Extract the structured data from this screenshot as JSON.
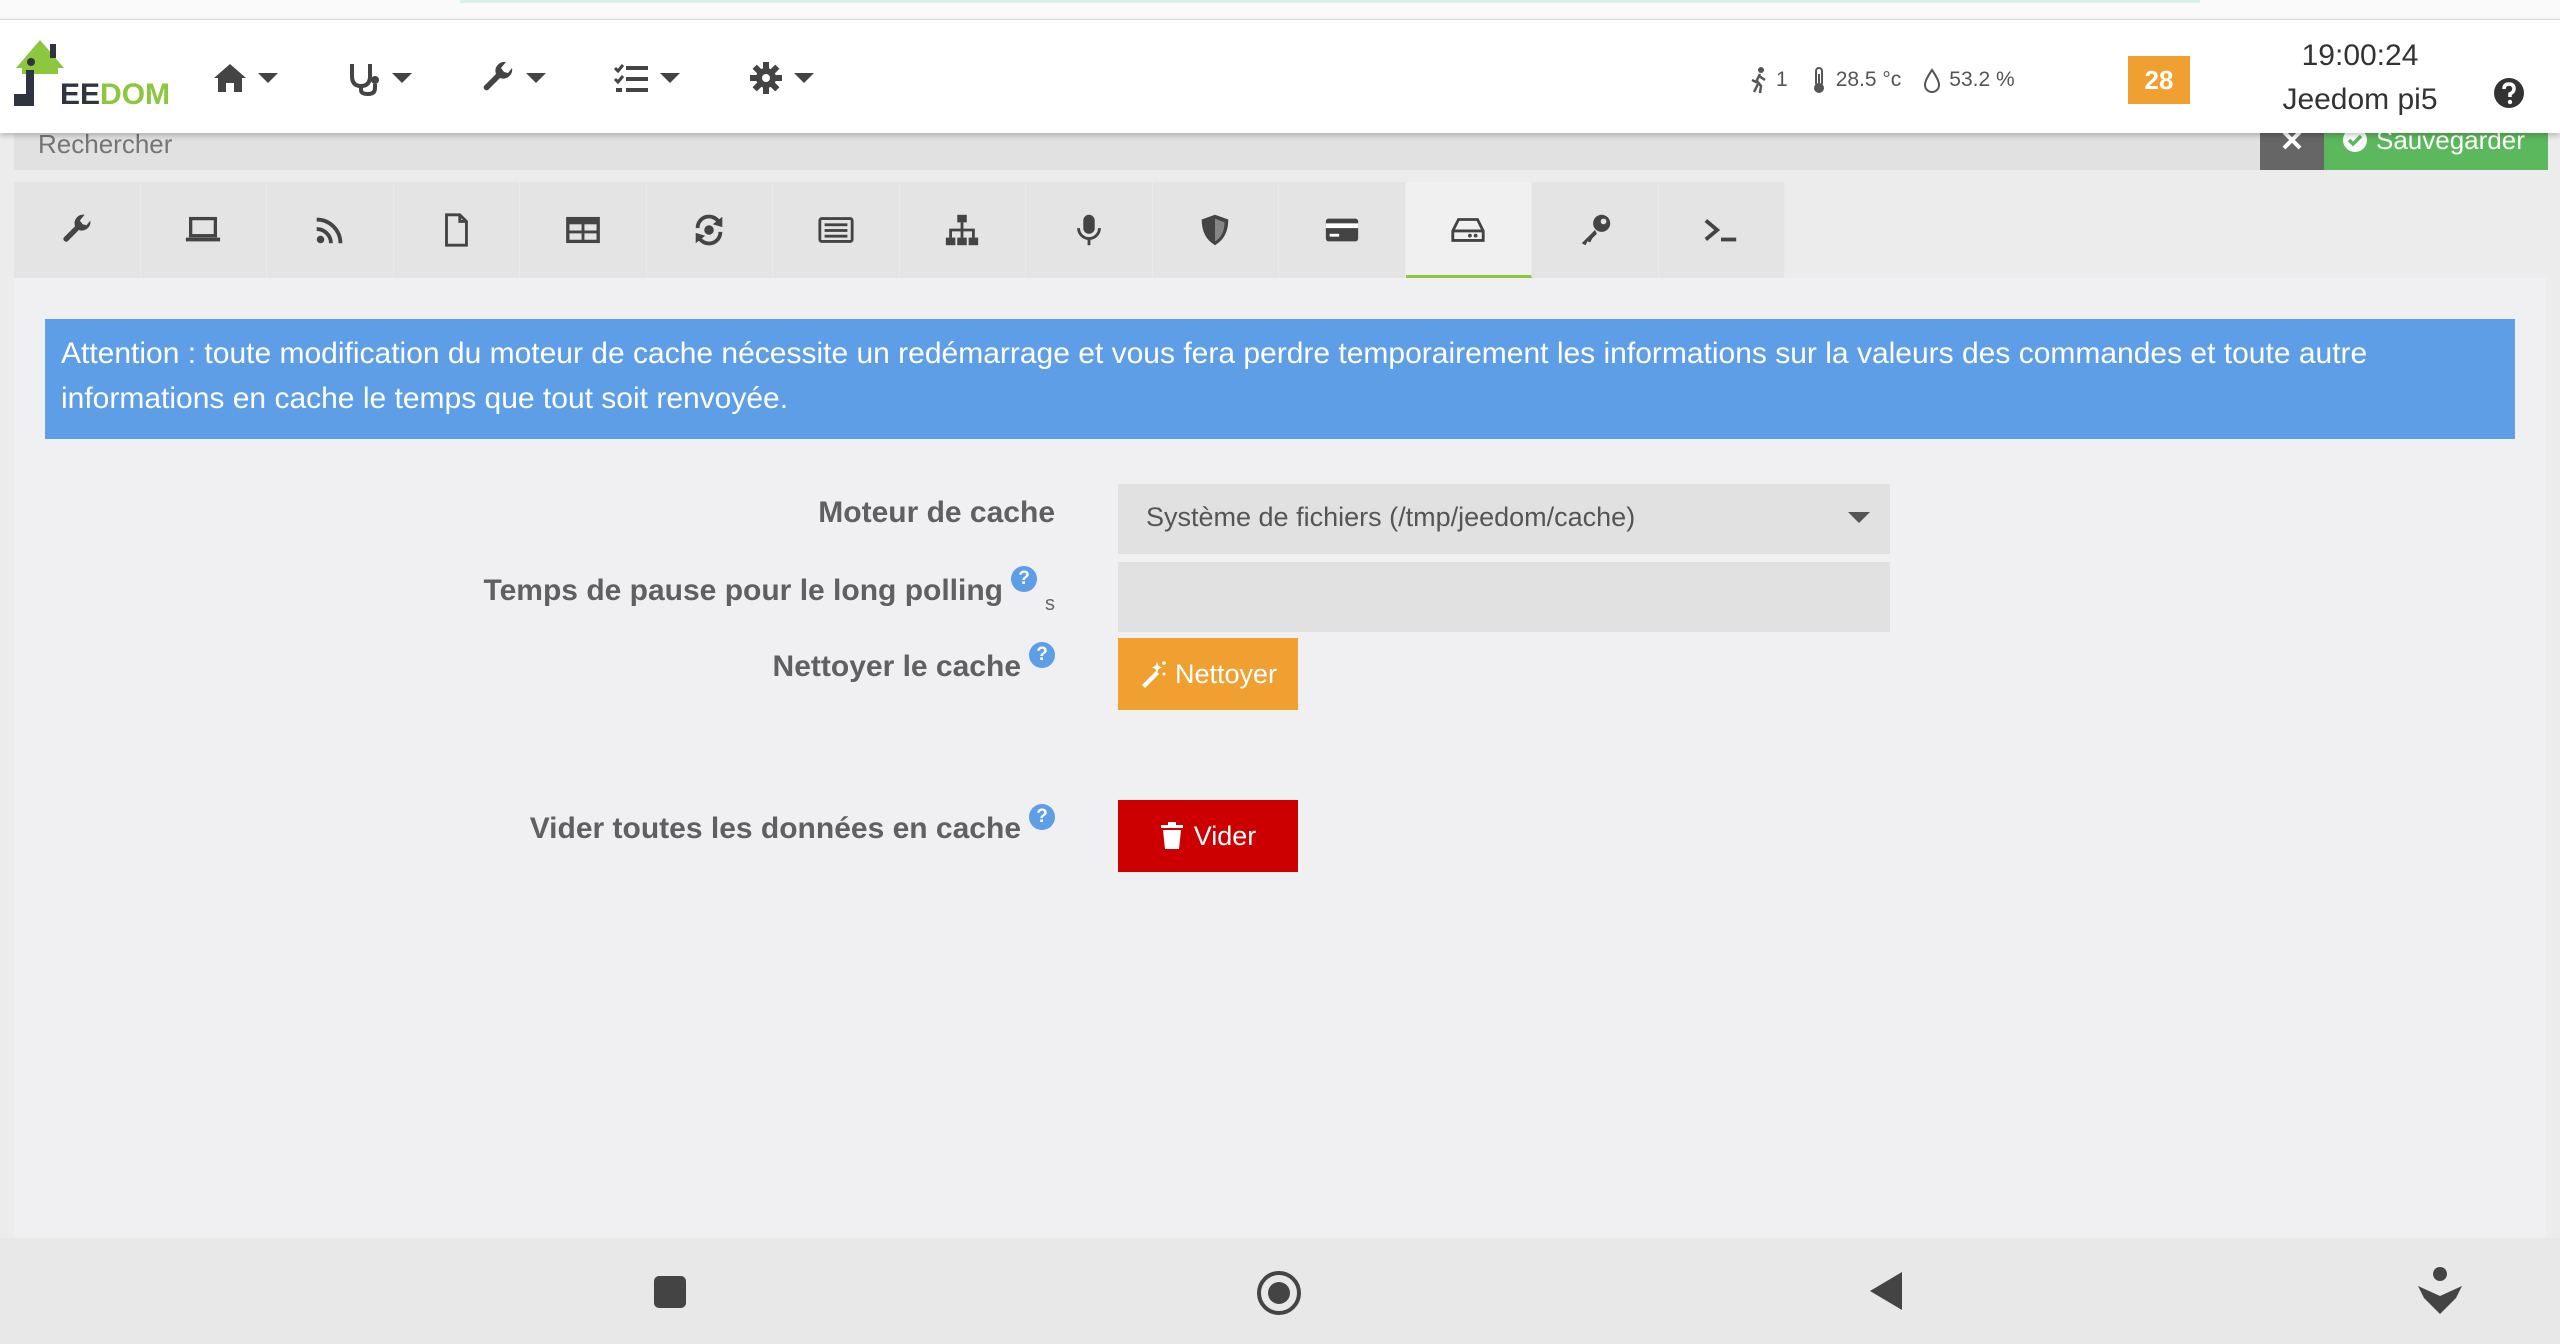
{
  "app": {
    "brand_prefix": "J",
    "brand_e": "EE",
    "brand_dom": "DOM"
  },
  "navbar": {
    "menus": [
      {
        "icon": "home-icon"
      },
      {
        "icon": "stethoscope-icon"
      },
      {
        "icon": "wrench-icon"
      },
      {
        "icon": "checklist-icon"
      },
      {
        "icon": "gear-icon"
      }
    ],
    "sensors": {
      "presence": "1",
      "temperature": "28.5 °c",
      "humidity": "53.2 %"
    },
    "notifications_count": "28",
    "time": "19:00:24",
    "hostname": "Jeedom pi5"
  },
  "search": {
    "placeholder": "Rechercher"
  },
  "toolbar": {
    "save_label": "Sauvegarder"
  },
  "tabs": [
    {
      "icon": "wrench-icon"
    },
    {
      "icon": "laptop-icon"
    },
    {
      "icon": "rss-icon"
    },
    {
      "icon": "file-icon"
    },
    {
      "icon": "table-icon"
    },
    {
      "icon": "sync-icon"
    },
    {
      "icon": "list-alt-icon"
    },
    {
      "icon": "sitemap-icon"
    },
    {
      "icon": "microphone-icon"
    },
    {
      "icon": "shield-icon"
    },
    {
      "icon": "credit-card-icon"
    },
    {
      "icon": "hdd-icon",
      "active": true
    },
    {
      "icon": "key-icon"
    },
    {
      "icon": "terminal-icon"
    }
  ],
  "alert": {
    "text": "Attention : toute modification du moteur de cache nécessite un redémarrage et vous fera perdre temporairement les informations sur la valeurs des commandes et toute autre informations en cache le temps que tout soit renvoyée."
  },
  "form": {
    "cache_engine": {
      "label": "Moteur de cache",
      "value": "Système de fichiers (/tmp/jeedom/cache)"
    },
    "long_polling": {
      "label": "Temps de pause pour le long polling",
      "unit": "s",
      "value": ""
    },
    "clean_cache": {
      "label": "Nettoyer le cache",
      "button": "Nettoyer"
    },
    "empty_cache": {
      "label": "Vider toutes les données en cache",
      "button": "Vider"
    },
    "help_glyph": "?"
  },
  "colors": {
    "accent_green": "#8dc63f",
    "alert_blue": "#5e9ee6",
    "warning_orange": "#f0a030",
    "danger_red": "#cc0000",
    "save_green": "#5cb85c"
  }
}
